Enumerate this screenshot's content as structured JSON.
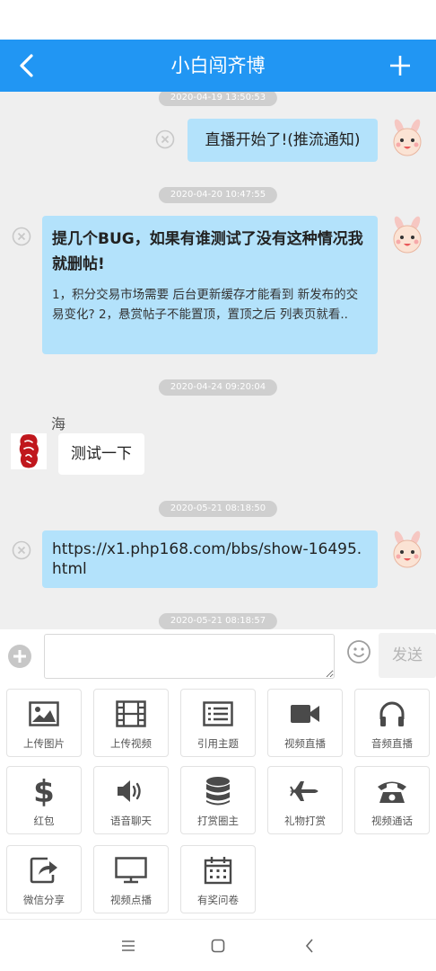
{
  "header": {
    "title": "小白闯齐博"
  },
  "messages": [
    {
      "timestamp": "2020-04-19 13:50:53",
      "text": "直播开始了!(推流通知)"
    },
    {
      "timestamp": "2020-04-20 10:47:55",
      "title": "提几个BUG，如果有谁测试了没有这种情况我就删帖!",
      "body": "1，积分交易市场需要 后台更新缓存才能看到 新发布的交易变化? 2，悬赏帖子不能置顶，置顶之后 列表页就看.."
    },
    {
      "timestamp": "2020-04-24 09:20:04",
      "sender": "海",
      "text": "测试一下"
    },
    {
      "timestamp": "2020-05-21 08:18:50",
      "text": "https://x1.php168.com/bbs/show-16495.html"
    },
    {
      "timestamp": "2020-05-21 08:18:57"
    }
  ],
  "input": {
    "value": "",
    "send_label": "发送"
  },
  "tools": [
    {
      "label": "上传图片",
      "icon": "image-icon"
    },
    {
      "label": "上传视频",
      "icon": "film-icon"
    },
    {
      "label": "引用主题",
      "icon": "list-icon"
    },
    {
      "label": "视频直播",
      "icon": "video-camera-icon"
    },
    {
      "label": "音频直播",
      "icon": "headphones-icon"
    },
    {
      "label": "红包",
      "icon": "dollar-icon"
    },
    {
      "label": "语音聊天",
      "icon": "speaker-icon"
    },
    {
      "label": "打赏圈主",
      "icon": "database-icon"
    },
    {
      "label": "礼物打赏",
      "icon": "plane-icon"
    },
    {
      "label": "视频通话",
      "icon": "phone-icon"
    },
    {
      "label": "微信分享",
      "icon": "share-icon"
    },
    {
      "label": "视频点播",
      "icon": "monitor-icon"
    },
    {
      "label": "有奖问卷",
      "icon": "calendar-icon"
    }
  ],
  "colors": {
    "header": "#2196f3",
    "bubble": "#b3e2fb",
    "chat_bg": "#efefef"
  }
}
